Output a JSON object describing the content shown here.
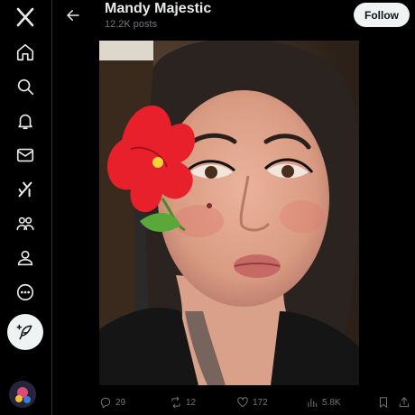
{
  "header": {
    "back_label": "Back",
    "profile_name": "Mandy Majestic",
    "post_count": "12.2K posts",
    "follow_label": "Follow"
  },
  "nav": {
    "items": [
      {
        "icon": "x-logo-icon"
      },
      {
        "icon": "home-icon"
      },
      {
        "icon": "search-icon"
      },
      {
        "icon": "bell-icon"
      },
      {
        "icon": "mail-icon"
      },
      {
        "icon": "grok-icon"
      },
      {
        "icon": "communities-icon"
      },
      {
        "icon": "profile-icon"
      },
      {
        "icon": "more-icon"
      }
    ],
    "compose_icon": "feather-plus-icon"
  },
  "media": {
    "description_colors": {
      "flower": "#e8202c",
      "skin": "#e8b39a",
      "hair": "#2a2320"
    }
  },
  "actions": {
    "replies": "29",
    "reposts": "12",
    "likes": "172",
    "views": "5.8K"
  },
  "colors": {
    "background": "#000000",
    "text_primary": "#e7e9ea",
    "text_secondary": "#71767b",
    "follow_bg": "#eff3f4"
  }
}
